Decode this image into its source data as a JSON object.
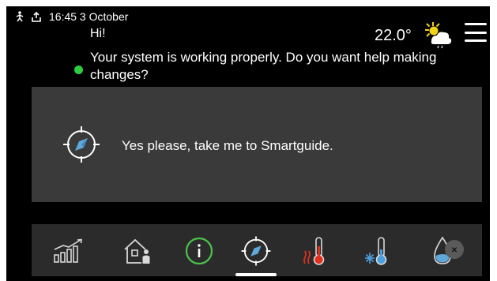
{
  "status_bar": {
    "icons": [
      "person-walking-icon",
      "upload-icon"
    ],
    "time_date": "16:45 3 October"
  },
  "greeting": "Hi!",
  "status": {
    "message": "Your system is working properly. Do you want help making changes?",
    "indicator_color": "#2ecc40"
  },
  "header": {
    "temperature": "22.0°",
    "weather_icon": "sun-cloud-rain-icon",
    "menu_icon": "hamburger-menu-icon"
  },
  "card": {
    "icon": "compass-icon",
    "label": "Yes please, take me to Smartguide."
  },
  "dock": {
    "items": [
      {
        "name": "energy-chart-icon"
      },
      {
        "name": "house-person-icon"
      },
      {
        "name": "info-icon",
        "color": "#4cc34c"
      },
      {
        "name": "compass-icon",
        "active": true
      },
      {
        "name": "heating-thermometer-icon",
        "color": "#e0301e"
      },
      {
        "name": "cooling-thermometer-icon",
        "color": "#4aa0e0"
      },
      {
        "name": "water-drop-icon",
        "color": "#5fa8d8"
      }
    ],
    "close_symbol": "×"
  }
}
